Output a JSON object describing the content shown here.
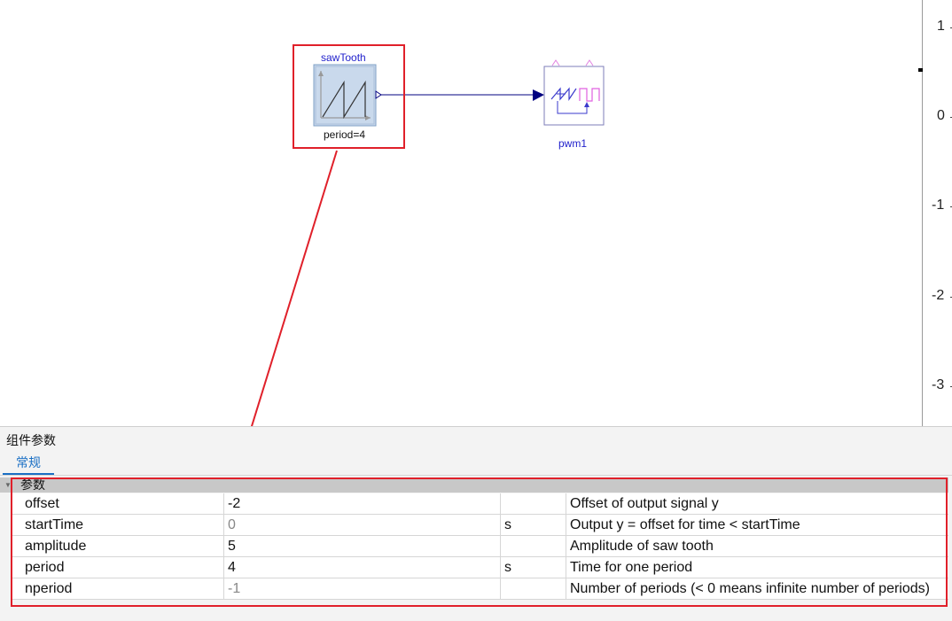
{
  "canvas": {
    "components": {
      "sawtooth": {
        "name": "sawTooth",
        "param": "period=4"
      },
      "pwm": {
        "name": "pwm1"
      }
    }
  },
  "ruler": {
    "ticks": [
      "1",
      "0",
      "-1",
      "-2",
      "-3"
    ]
  },
  "panel": {
    "title": "组件参数",
    "tabs": [
      {
        "label": "常规",
        "active": true
      }
    ],
    "group_label": "参数",
    "rows": [
      {
        "name": "offset",
        "value": "-2",
        "unit": "",
        "description": "Offset of output signal y",
        "value_default": false
      },
      {
        "name": "startTime",
        "value": "0",
        "unit": "s",
        "description": "Output y = offset for time < startTime",
        "value_default": true
      },
      {
        "name": "amplitude",
        "value": "5",
        "unit": "",
        "description": "Amplitude of saw tooth",
        "value_default": false
      },
      {
        "name": "period",
        "value": "4",
        "unit": "s",
        "description": "Time for one period",
        "value_default": false
      },
      {
        "name": "nperiod",
        "value": "-1",
        "unit": "",
        "description": "Number of periods (< 0 means infinite number of periods)",
        "value_default": true
      }
    ]
  },
  "colors": {
    "highlight": "#e0202a",
    "connection": "#000080",
    "accent": "#1a6fc4"
  }
}
